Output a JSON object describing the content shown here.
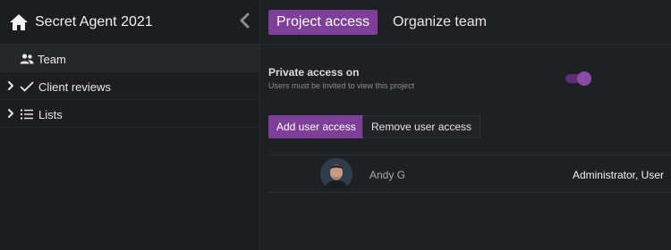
{
  "sidebar": {
    "title": "Secret Agent 2021",
    "items": [
      {
        "label": "Team",
        "icon": "team-icon",
        "active": true,
        "expandable": false
      },
      {
        "label": "Client reviews",
        "icon": "checkmark-icon",
        "active": false,
        "expandable": true
      },
      {
        "label": "Lists",
        "icon": "list-icon",
        "active": false,
        "expandable": true
      }
    ]
  },
  "tabs": [
    {
      "label": "Project access",
      "active": true
    },
    {
      "label": "Organize team",
      "active": false
    }
  ],
  "access": {
    "title": "Private access on",
    "subtitle": "Users must be invited to view this project",
    "enabled": true
  },
  "buttons": {
    "add": "Add user access",
    "remove": "Remove user access"
  },
  "users": [
    {
      "name": "Andy G",
      "role": "Administrator, User"
    }
  ],
  "colors": {
    "accent": "#7e3f98",
    "background": "#1e1f22",
    "toggle_track": "#5e2f74"
  }
}
